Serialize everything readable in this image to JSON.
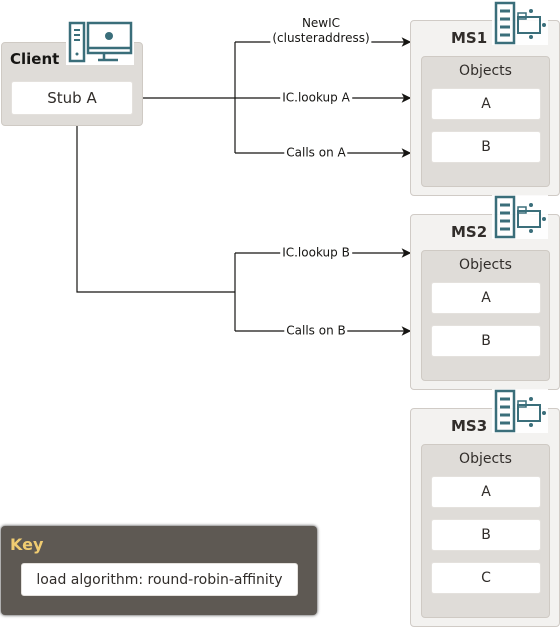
{
  "client": {
    "title": "Client",
    "stub": "Stub A",
    "icon": "desktop-computer-icon"
  },
  "connections": {
    "newic": [
      "NewIC",
      "(clusteraddress)"
    ],
    "lookup_a": "IC.lookup A",
    "calls_a": "Calls on A",
    "lookup_b": "IC.lookup B",
    "calls_b": "Calls on B"
  },
  "servers": [
    {
      "name": "MS1",
      "objects_label": "Objects",
      "objects": [
        "A",
        "B"
      ],
      "icon": "server-icon"
    },
    {
      "name": "MS2",
      "objects_label": "Objects",
      "objects": [
        "A",
        "B"
      ],
      "icon": "server-icon"
    },
    {
      "name": "MS3",
      "objects_label": "Objects",
      "objects": [
        "A",
        "B",
        "C"
      ],
      "icon": "server-icon"
    }
  ],
  "key": {
    "title": "Key",
    "text": "load algorithm: round-robin-affinity"
  },
  "colors": {
    "icon": "#3a6e7a",
    "key_title": "#f0cc71",
    "key_bg": "#5e5953",
    "box": "#dfdcd8"
  }
}
